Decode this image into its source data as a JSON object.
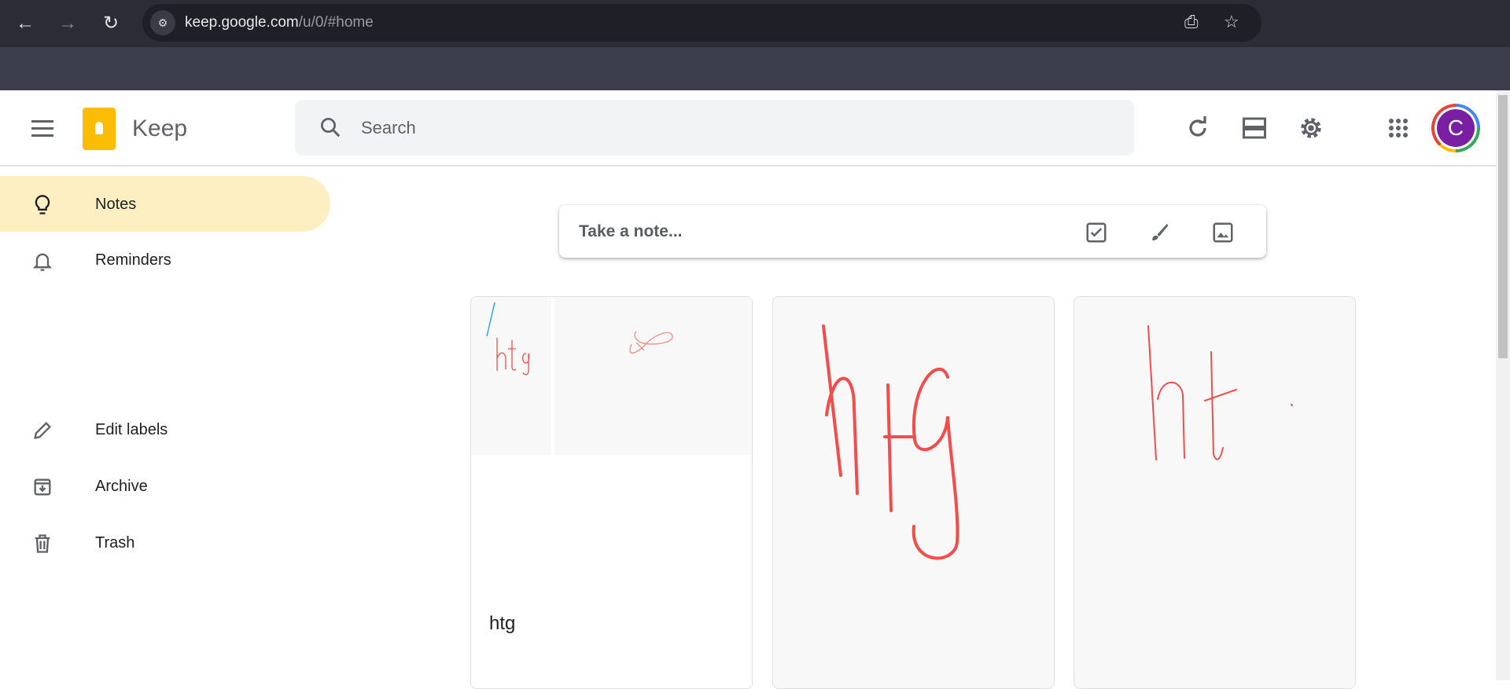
{
  "browser": {
    "url_host": "keep.google.com",
    "url_path": "/u/0/#home"
  },
  "header": {
    "app_name": "Keep",
    "search_placeholder": "Search",
    "avatar_letter": "C"
  },
  "sidebar": {
    "items": [
      {
        "label": "Notes",
        "icon": "lightbulb-icon",
        "active": true
      },
      {
        "label": "Reminders",
        "icon": "bell-icon"
      },
      {
        "label": "Edit labels",
        "icon": "pencil-icon"
      },
      {
        "label": "Archive",
        "icon": "archive-icon"
      },
      {
        "label": "Trash",
        "icon": "trash-icon"
      }
    ]
  },
  "composer": {
    "placeholder": "Take a note..."
  },
  "notes": [
    {
      "title": "htg",
      "drawing": "htg"
    },
    {
      "drawing": "htg"
    },
    {
      "drawing": "ht"
    }
  ],
  "colors": {
    "accent": "#feefc3",
    "ink": "#f44b4b",
    "avatar": "#7b1fa2"
  }
}
